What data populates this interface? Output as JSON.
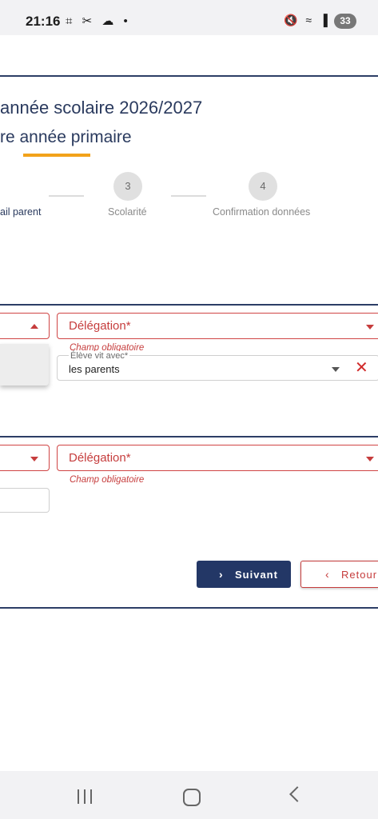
{
  "status_bar": {
    "time": "21:16",
    "left_icons": "⌗ ✂ ☁ •",
    "right_icons": "🔇 ≈ ▐",
    "battery": "33"
  },
  "header": {
    "title": "année scolaire 2026/2027",
    "subtitle": "re année primaire"
  },
  "stepper": {
    "steps": [
      {
        "number": "",
        "label": "ail parent",
        "active": true
      },
      {
        "number": "3",
        "label": "Scolarité"
      },
      {
        "number": "4",
        "label": "Confirmation données"
      }
    ]
  },
  "section1": {
    "delegation_label": "Délégation*",
    "delegation_error": "Champ obligatoire",
    "lives_with_label": "Élève vit avec*",
    "lives_with_value": "les parents"
  },
  "section2": {
    "delegation_label": "Délégation*",
    "delegation_error": "Champ obligatoire"
  },
  "actions": {
    "next_label": "Suivant",
    "next_icon": "chevron-right-icon",
    "back_label": "Retour",
    "back_icon": "chevron-left-icon"
  },
  "colors": {
    "primary": "#233766",
    "error": "#c63d3d",
    "accent": "#f2a21a"
  }
}
